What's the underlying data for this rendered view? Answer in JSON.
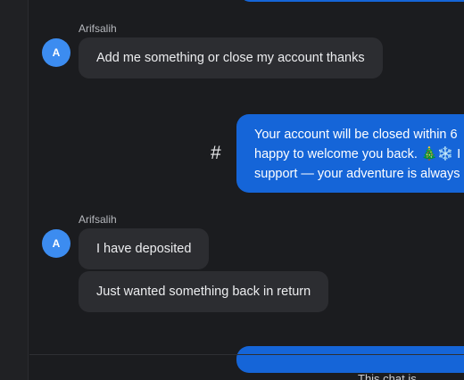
{
  "messages": {
    "group1": {
      "author": "Arifsalih",
      "avatar_initial": "A",
      "text": "Add me something or close my account thanks"
    },
    "reply": {
      "hash_icon": "#",
      "line1": "Your account will be closed within 6",
      "line2": "happy to welcome you back. 🎄❄️ I",
      "line3": "support — your adventure is always"
    },
    "group2": {
      "author": "Arifsalih",
      "avatar_initial": "A",
      "text1": "I have deposited",
      "text2": "Just wanted something back in return"
    }
  },
  "footer": {
    "text": "This chat is ..."
  },
  "colors": {
    "background": "#1b1c1f",
    "incoming_bubble": "#2c2d31",
    "outgoing_bubble": "#1565d8",
    "avatar": "#3c8cf0"
  }
}
